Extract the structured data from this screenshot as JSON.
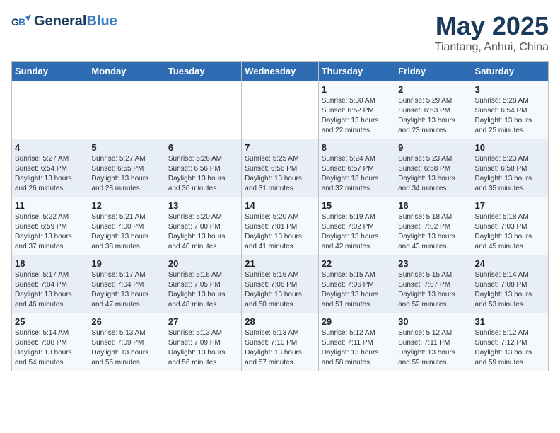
{
  "header": {
    "logo_general": "General",
    "logo_blue": "Blue",
    "month": "May 2025",
    "location": "Tiantang, Anhui, China"
  },
  "days_of_week": [
    "Sunday",
    "Monday",
    "Tuesday",
    "Wednesday",
    "Thursday",
    "Friday",
    "Saturday"
  ],
  "weeks": [
    [
      {
        "day": "",
        "info": ""
      },
      {
        "day": "",
        "info": ""
      },
      {
        "day": "",
        "info": ""
      },
      {
        "day": "",
        "info": ""
      },
      {
        "day": "1",
        "info": "Sunrise: 5:30 AM\nSunset: 6:52 PM\nDaylight: 13 hours\nand 22 minutes."
      },
      {
        "day": "2",
        "info": "Sunrise: 5:29 AM\nSunset: 6:53 PM\nDaylight: 13 hours\nand 23 minutes."
      },
      {
        "day": "3",
        "info": "Sunrise: 5:28 AM\nSunset: 6:54 PM\nDaylight: 13 hours\nand 25 minutes."
      }
    ],
    [
      {
        "day": "4",
        "info": "Sunrise: 5:27 AM\nSunset: 6:54 PM\nDaylight: 13 hours\nand 26 minutes."
      },
      {
        "day": "5",
        "info": "Sunrise: 5:27 AM\nSunset: 6:55 PM\nDaylight: 13 hours\nand 28 minutes."
      },
      {
        "day": "6",
        "info": "Sunrise: 5:26 AM\nSunset: 6:56 PM\nDaylight: 13 hours\nand 30 minutes."
      },
      {
        "day": "7",
        "info": "Sunrise: 5:25 AM\nSunset: 6:56 PM\nDaylight: 13 hours\nand 31 minutes."
      },
      {
        "day": "8",
        "info": "Sunrise: 5:24 AM\nSunset: 6:57 PM\nDaylight: 13 hours\nand 32 minutes."
      },
      {
        "day": "9",
        "info": "Sunrise: 5:23 AM\nSunset: 6:58 PM\nDaylight: 13 hours\nand 34 minutes."
      },
      {
        "day": "10",
        "info": "Sunrise: 5:23 AM\nSunset: 6:58 PM\nDaylight: 13 hours\nand 35 minutes."
      }
    ],
    [
      {
        "day": "11",
        "info": "Sunrise: 5:22 AM\nSunset: 6:59 PM\nDaylight: 13 hours\nand 37 minutes."
      },
      {
        "day": "12",
        "info": "Sunrise: 5:21 AM\nSunset: 7:00 PM\nDaylight: 13 hours\nand 38 minutes."
      },
      {
        "day": "13",
        "info": "Sunrise: 5:20 AM\nSunset: 7:00 PM\nDaylight: 13 hours\nand 40 minutes."
      },
      {
        "day": "14",
        "info": "Sunrise: 5:20 AM\nSunset: 7:01 PM\nDaylight: 13 hours\nand 41 minutes."
      },
      {
        "day": "15",
        "info": "Sunrise: 5:19 AM\nSunset: 7:02 PM\nDaylight: 13 hours\nand 42 minutes."
      },
      {
        "day": "16",
        "info": "Sunrise: 5:18 AM\nSunset: 7:02 PM\nDaylight: 13 hours\nand 43 minutes."
      },
      {
        "day": "17",
        "info": "Sunrise: 5:18 AM\nSunset: 7:03 PM\nDaylight: 13 hours\nand 45 minutes."
      }
    ],
    [
      {
        "day": "18",
        "info": "Sunrise: 5:17 AM\nSunset: 7:04 PM\nDaylight: 13 hours\nand 46 minutes."
      },
      {
        "day": "19",
        "info": "Sunrise: 5:17 AM\nSunset: 7:04 PM\nDaylight: 13 hours\nand 47 minutes."
      },
      {
        "day": "20",
        "info": "Sunrise: 5:16 AM\nSunset: 7:05 PM\nDaylight: 13 hours\nand 48 minutes."
      },
      {
        "day": "21",
        "info": "Sunrise: 5:16 AM\nSunset: 7:06 PM\nDaylight: 13 hours\nand 50 minutes."
      },
      {
        "day": "22",
        "info": "Sunrise: 5:15 AM\nSunset: 7:06 PM\nDaylight: 13 hours\nand 51 minutes."
      },
      {
        "day": "23",
        "info": "Sunrise: 5:15 AM\nSunset: 7:07 PM\nDaylight: 13 hours\nand 52 minutes."
      },
      {
        "day": "24",
        "info": "Sunrise: 5:14 AM\nSunset: 7:08 PM\nDaylight: 13 hours\nand 53 minutes."
      }
    ],
    [
      {
        "day": "25",
        "info": "Sunrise: 5:14 AM\nSunset: 7:08 PM\nDaylight: 13 hours\nand 54 minutes."
      },
      {
        "day": "26",
        "info": "Sunrise: 5:13 AM\nSunset: 7:09 PM\nDaylight: 13 hours\nand 55 minutes."
      },
      {
        "day": "27",
        "info": "Sunrise: 5:13 AM\nSunset: 7:09 PM\nDaylight: 13 hours\nand 56 minutes."
      },
      {
        "day": "28",
        "info": "Sunrise: 5:13 AM\nSunset: 7:10 PM\nDaylight: 13 hours\nand 57 minutes."
      },
      {
        "day": "29",
        "info": "Sunrise: 5:12 AM\nSunset: 7:11 PM\nDaylight: 13 hours\nand 58 minutes."
      },
      {
        "day": "30",
        "info": "Sunrise: 5:12 AM\nSunset: 7:11 PM\nDaylight: 13 hours\nand 59 minutes."
      },
      {
        "day": "31",
        "info": "Sunrise: 5:12 AM\nSunset: 7:12 PM\nDaylight: 13 hours\nand 59 minutes."
      }
    ]
  ]
}
